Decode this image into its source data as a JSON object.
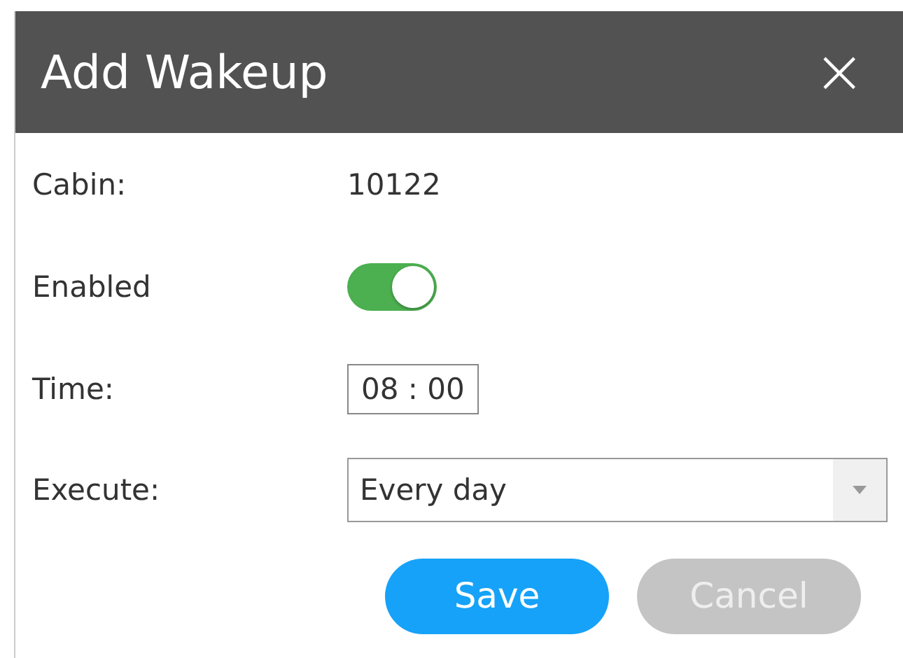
{
  "dialog": {
    "title": "Add Wakeup",
    "close": "×"
  },
  "fields": [
    {
      "kind": "text",
      "label": "Cabin:",
      "value": "10122"
    },
    {
      "kind": "toggle",
      "label": "Enabled",
      "on": true
    },
    {
      "kind": "time",
      "label": "Time:",
      "value": "08 : 00"
    },
    {
      "kind": "select",
      "label": "Execute:",
      "value": "Every day"
    }
  ],
  "buttons": [
    {
      "kind": "primary",
      "label": "Save"
    },
    {
      "kind": "secondary",
      "label": "Cancel"
    }
  ]
}
